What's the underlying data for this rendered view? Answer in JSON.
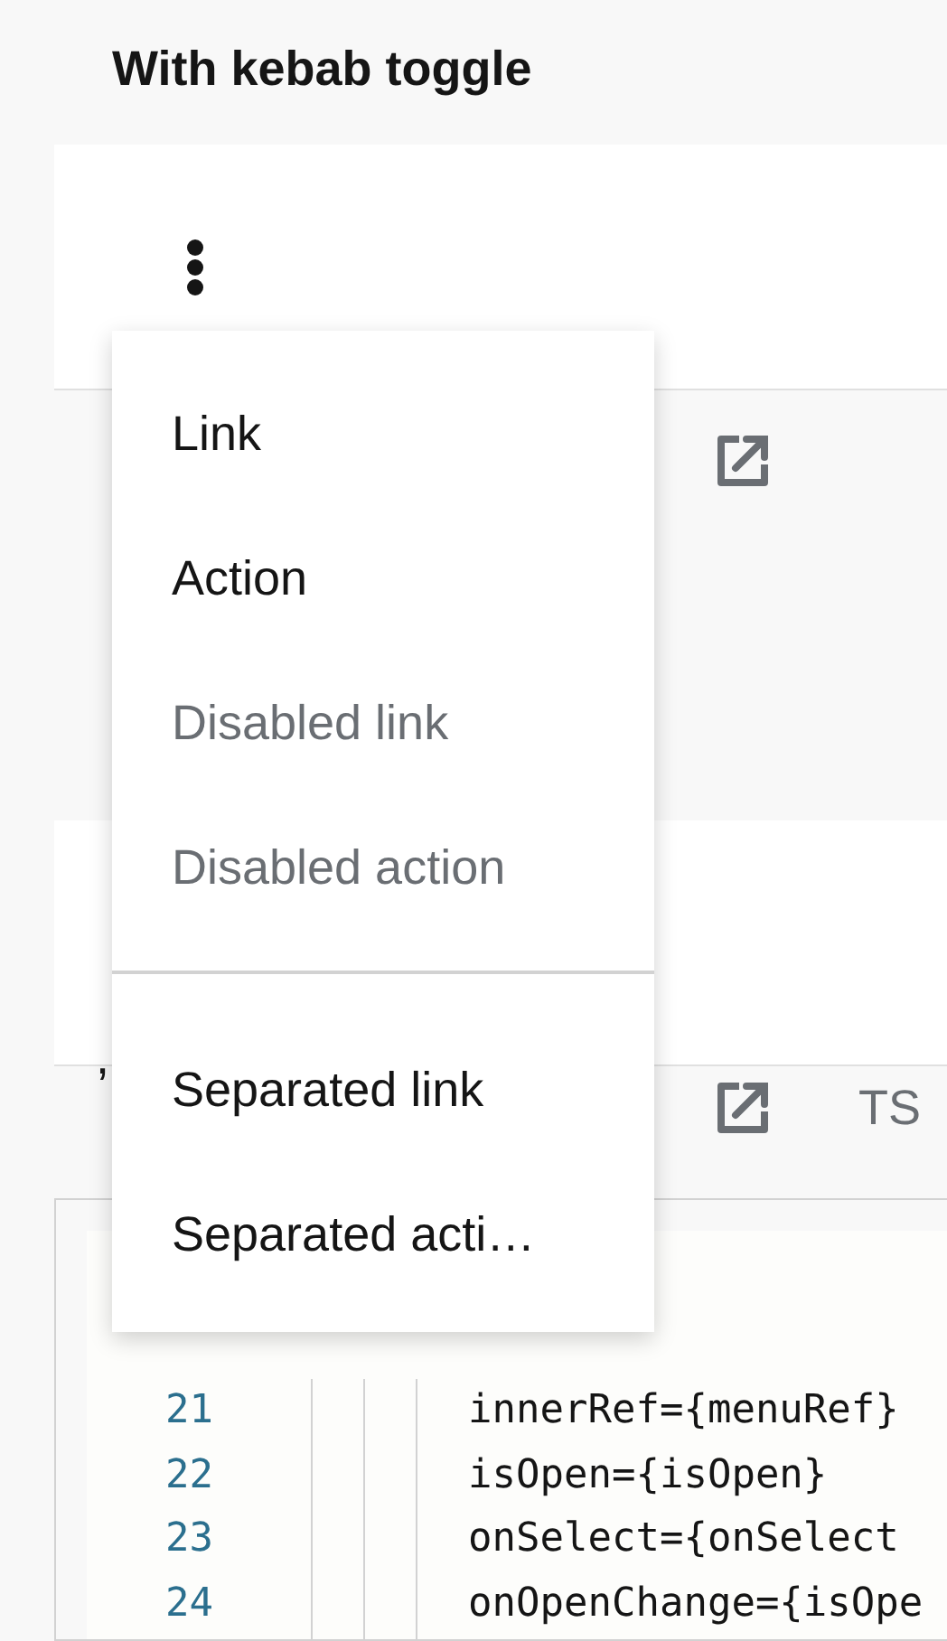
{
  "heading": "With kebab toggle",
  "menu": {
    "groups": [
      [
        {
          "label": "Link",
          "disabled": false
        },
        {
          "label": "Action",
          "disabled": false
        },
        {
          "label": "Disabled link",
          "disabled": true
        },
        {
          "label": "Disabled action",
          "disabled": true
        }
      ],
      [
        {
          "label": "Separated link",
          "disabled": false
        },
        {
          "label": "Separated acti…",
          "disabled": false
        }
      ]
    ]
  },
  "stray_text": ",",
  "toolbar_2": {
    "language": "TS"
  },
  "code": [
    {
      "number": "21",
      "text": "innerRef={menuRef}"
    },
    {
      "number": "22",
      "text": "isOpen={isOpen}"
    },
    {
      "number": "23",
      "text": "onSelect={onSelect"
    },
    {
      "number": "24",
      "text": "onOpenChange={isOpe"
    }
  ]
}
